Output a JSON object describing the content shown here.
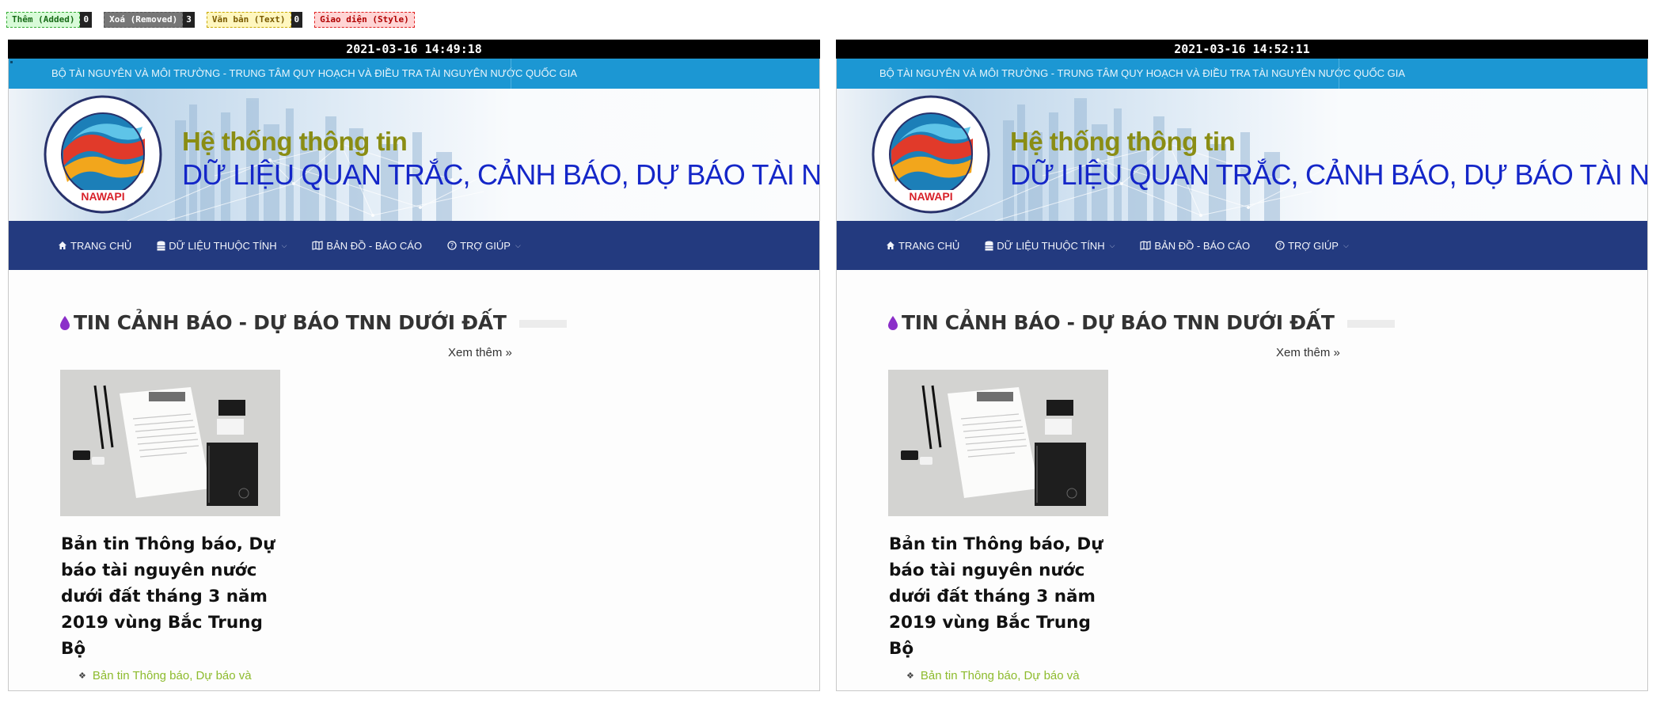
{
  "legend": [
    {
      "label": "Thêm (Added)",
      "count": "0"
    },
    {
      "label": "Xoá (Removed)",
      "count": "3"
    },
    {
      "label": "Văn bản (Text)",
      "count": "0"
    },
    {
      "label": "Giao diện (Style)",
      "count": ""
    }
  ],
  "panels": [
    {
      "timestamp": "2021-03-16 14:49:18"
    },
    {
      "timestamp": "2021-03-16 14:52:11"
    }
  ],
  "site": {
    "topbar_text": "BỘ TÀI NGUYÊN VÀ MÔI TRƯỜNG - TRUNG TÂM QUY HOẠCH VÀ ĐIỀU TRA TÀI NGUYÊN NƯỚC QUỐC GIA",
    "banner_title1": "Hệ thống thông tin",
    "banner_title2": "DỮ LIỆU QUAN TRẮC, CẢNH BÁO, DỰ BÁO TÀI NGUY",
    "logo_text": "NAWAPI",
    "nav": [
      {
        "label": "TRANG CHỦ",
        "icon": "home-icon"
      },
      {
        "label": "DỮ LIỆU THUỘC TÍNH",
        "icon": "database-icon"
      },
      {
        "label": "BẢN ĐỒ - BÁO CÁO",
        "icon": "map-icon"
      },
      {
        "label": "TRỢ GIÚP",
        "icon": "help-circle-icon"
      }
    ],
    "section_title": "TIN CẢNH BÁO - DỰ BÁO TNN DƯỚI ĐẤT",
    "more_link": "Xem thêm »",
    "article_title": "Bản tin Thông báo, Dự báo tài nguyên nước dưới đất tháng 3 năm 2019 vùng Bắc Trung Bộ",
    "sub_link": "Bản tin Thông báo, Dự báo và"
  },
  "colors": {
    "topbar": "#1c97d3",
    "navbar": "#233a7f",
    "title_olive": "#8a8d14",
    "title_blue": "#1426c8",
    "link_green": "#8dbb2d"
  }
}
